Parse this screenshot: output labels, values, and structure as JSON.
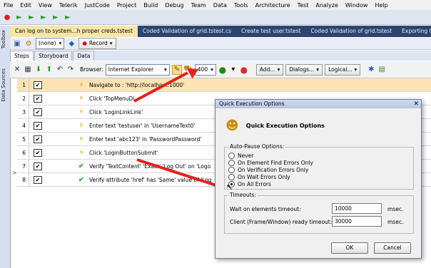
{
  "menu": [
    "File",
    "Edit",
    "View",
    "Telerik",
    "JustCode",
    "Project",
    "Build",
    "Debug",
    "Team",
    "Data",
    "Tools",
    "Architecture",
    "Test",
    "Analyze",
    "Window",
    "Help"
  ],
  "side": {
    "toolbox": "Toolbox",
    "data_sources": "Data Sources"
  },
  "doc_tabs": [
    "Can log on to system...h proper creds.tstest",
    "Coded Validation of grid.tstest.cs",
    "Create test user.tstest",
    "Coded Validation of grid.tstest",
    "Exporting G"
  ],
  "toolbar1": {
    "none_label": "(none)",
    "record_label": "Record"
  },
  "test_tabs": [
    "Steps",
    "Storyboard",
    "Data"
  ],
  "toolbar2": {
    "browser_label": "Browser:",
    "browser_value": "Internet Explorer",
    "delay_value": "400",
    "add_label": "Add...",
    "dialogs_label": "Dialogs...",
    "logical_label": "Logical..."
  },
  "steps": [
    {
      "num": "1",
      "text": "Navigate to : 'http://localhost:1000'",
      "icon": "lightning"
    },
    {
      "num": "2",
      "text": "Click 'TopMenuDi",
      "icon": "lightning"
    },
    {
      "num": "3",
      "text": "Click 'LoginLinkLink'",
      "icon": "lightning"
    },
    {
      "num": "4",
      "text": "Enter text 'testuser' in 'UsernameText0'",
      "icon": "lightning"
    },
    {
      "num": "5",
      "text": "Enter text 'abc123' in 'PasswordPassword'",
      "icon": "lightning"
    },
    {
      "num": "6",
      "text": "Click 'LoginButtonSubmit'",
      "icon": "lightning"
    },
    {
      "num": "7",
      "text": "Verify 'TextContent' 'Exact' 'Log Out' on 'Logo",
      "icon": "check"
    },
    {
      "num": "8",
      "text": "Verify attribute 'href' has 'Same' value of 'Log",
      "icon": "check"
    }
  ],
  "dialog": {
    "title": "Quick Execution Options",
    "heading": "Quick Execution Options",
    "close": "✕",
    "autopause_label": "Auto-Pause Options:",
    "options": [
      "Never",
      "On Element Find Errors Only",
      "On Verification Errors Only",
      "On Wait Errors Only",
      "On All Errors"
    ],
    "selected_index": 4,
    "timeouts_label": "Timeouts:",
    "wait_label": "Wait on elements timeout:",
    "wait_value": "10000",
    "client_label": "Client (Frame/Window) ready timeout:",
    "client_value": "30000",
    "unit": "msec.",
    "ok": "OK",
    "cancel": "Cancel"
  },
  "colors": {
    "accent_arrow": "#e0231e",
    "selected_row": "#fbe3b4",
    "tab_bar": "#2d4470"
  }
}
